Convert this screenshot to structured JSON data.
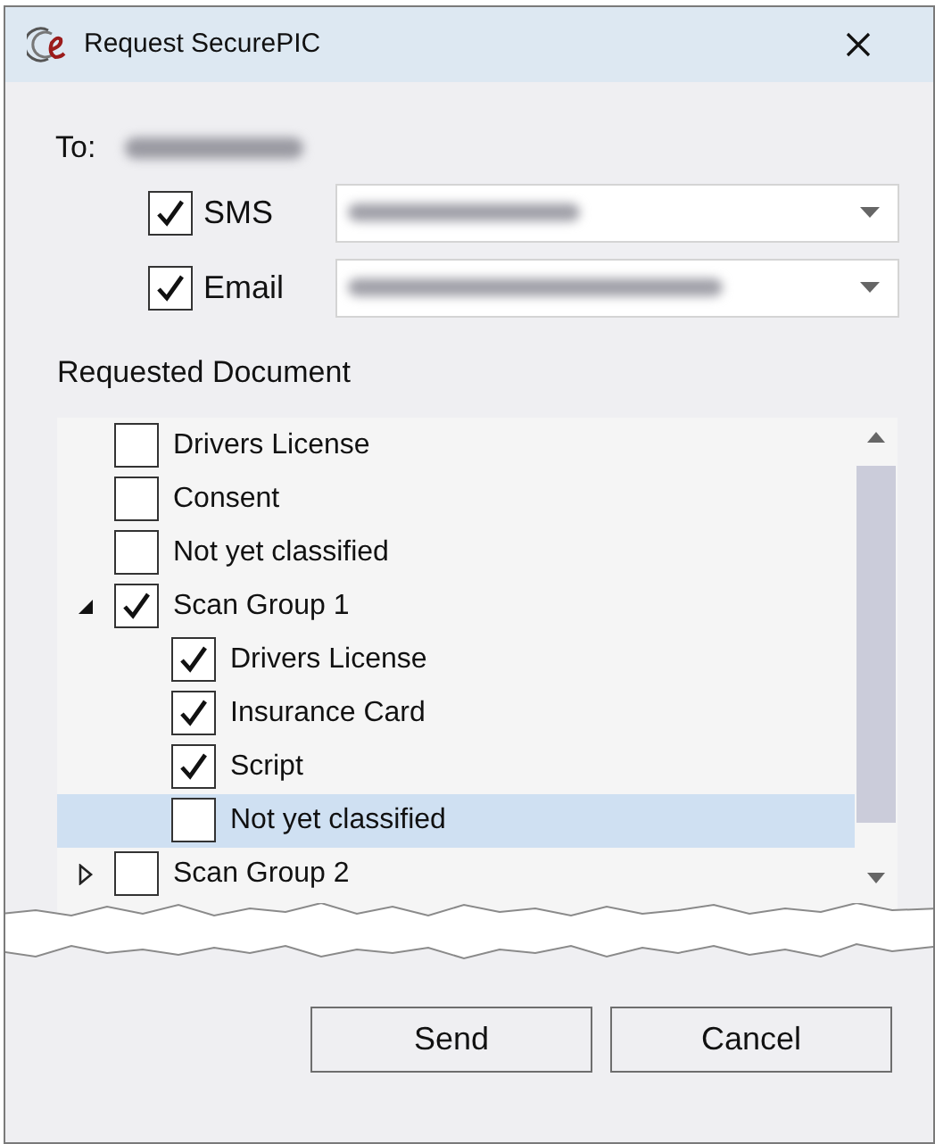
{
  "window": {
    "title": "Request SecurePIC"
  },
  "to": {
    "label": "To:"
  },
  "channels": [
    {
      "label": "SMS",
      "checked": true
    },
    {
      "label": "Email",
      "checked": true
    }
  ],
  "documents": {
    "label": "Requested Document",
    "items": [
      {
        "label": "Drivers License",
        "checked": false,
        "selected": false
      },
      {
        "label": "Consent",
        "checked": false,
        "selected": false
      },
      {
        "label": "Not yet classified",
        "checked": false,
        "selected": false
      },
      {
        "label": "Scan Group 1",
        "checked": true,
        "selected": false,
        "expanded": true,
        "children": [
          {
            "label": "Drivers License",
            "checked": true,
            "selected": false
          },
          {
            "label": "Insurance Card",
            "checked": true,
            "selected": false
          },
          {
            "label": "Script",
            "checked": true,
            "selected": false
          },
          {
            "label": "Not yet classified",
            "checked": false,
            "selected": true
          }
        ]
      },
      {
        "label": "Scan Group 2",
        "checked": false,
        "selected": false,
        "expanded": false
      }
    ]
  },
  "buttons": [
    "Send",
    "Cancel"
  ]
}
